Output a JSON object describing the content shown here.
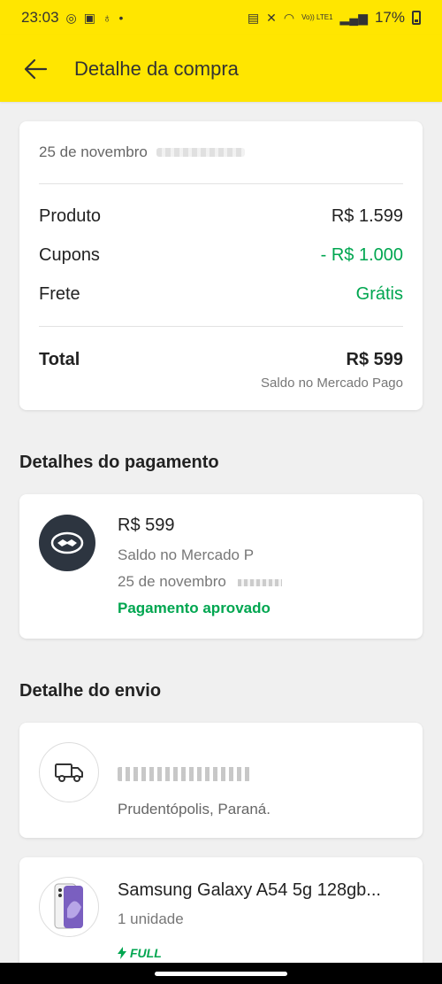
{
  "statusbar": {
    "time": "23:03",
    "battery": "17%",
    "network": "Vo)) LTE1"
  },
  "appbar": {
    "title": "Detalhe da compra",
    "back_icon": "arrow-left-icon"
  },
  "summary": {
    "date": "25 de novembro",
    "rows": [
      {
        "label": "Produto",
        "value": "R$ 1.599"
      },
      {
        "label": "Cupons",
        "value": "- R$ 1.000"
      },
      {
        "label": "Frete",
        "value": "Grátis"
      }
    ],
    "total_label": "Total",
    "total_value": "R$ 599",
    "total_sub": "Saldo no Mercado Pago"
  },
  "payment": {
    "section_title": "Detalhes do pagamento",
    "amount": "R$ 599",
    "method": "Saldo no Mercado P",
    "date": "25 de novembro",
    "status": "Pagamento aprovado",
    "icon": "handshake-icon"
  },
  "shipping": {
    "section_title": "Detalhe do envio",
    "city": "Prudentópolis, Paraná.",
    "icon": "truck-icon"
  },
  "product": {
    "title": "Samsung Galaxy A54 5g 128gb...",
    "quantity": "1 unidade",
    "badge": "FULL"
  },
  "colors": {
    "brand_yellow": "#ffe600",
    "green": "#00a650"
  }
}
